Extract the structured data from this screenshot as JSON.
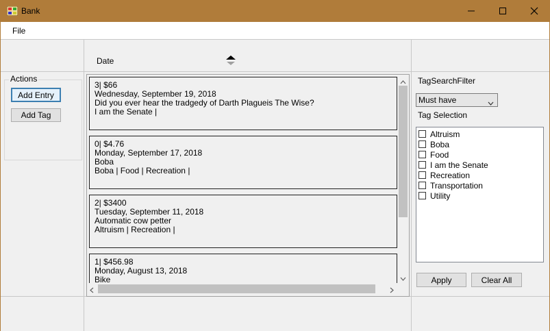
{
  "window": {
    "title": "Bank"
  },
  "menu": {
    "file": "File"
  },
  "actions": {
    "label": "Actions",
    "add_entry": "Add Entry",
    "add_tag": "Add Tag"
  },
  "list_header": {
    "date": "Date"
  },
  "entries": [
    {
      "amount": "3| $66",
      "date": "Wednesday, September 19, 2018",
      "description": "Did  you ever hear the tradgedy of Darth Plagueis The Wise?",
      "tags": "I am the Senate |"
    },
    {
      "amount": "0| $4.76",
      "date": "Monday, September 17, 2018",
      "description": "Boba",
      "tags": "Boba | Food | Recreation |"
    },
    {
      "amount": "2| $3400",
      "date": "Tuesday, September 11, 2018",
      "description": "Automatic cow petter",
      "tags": "Altruism | Recreation |"
    },
    {
      "amount": "1| $456.98",
      "date": "Monday, August 13, 2018",
      "description": "Bike",
      "tags": ""
    }
  ],
  "filter": {
    "label": "TagSearchFilter",
    "selected": "Must have",
    "tag_selection_label": "Tag Selection",
    "tags": [
      "Altruism",
      "Boba",
      "Food",
      "I am the Senate",
      "Recreation",
      "Transportation",
      "Utility"
    ],
    "apply": "Apply",
    "clear_all": "Clear All"
  }
}
